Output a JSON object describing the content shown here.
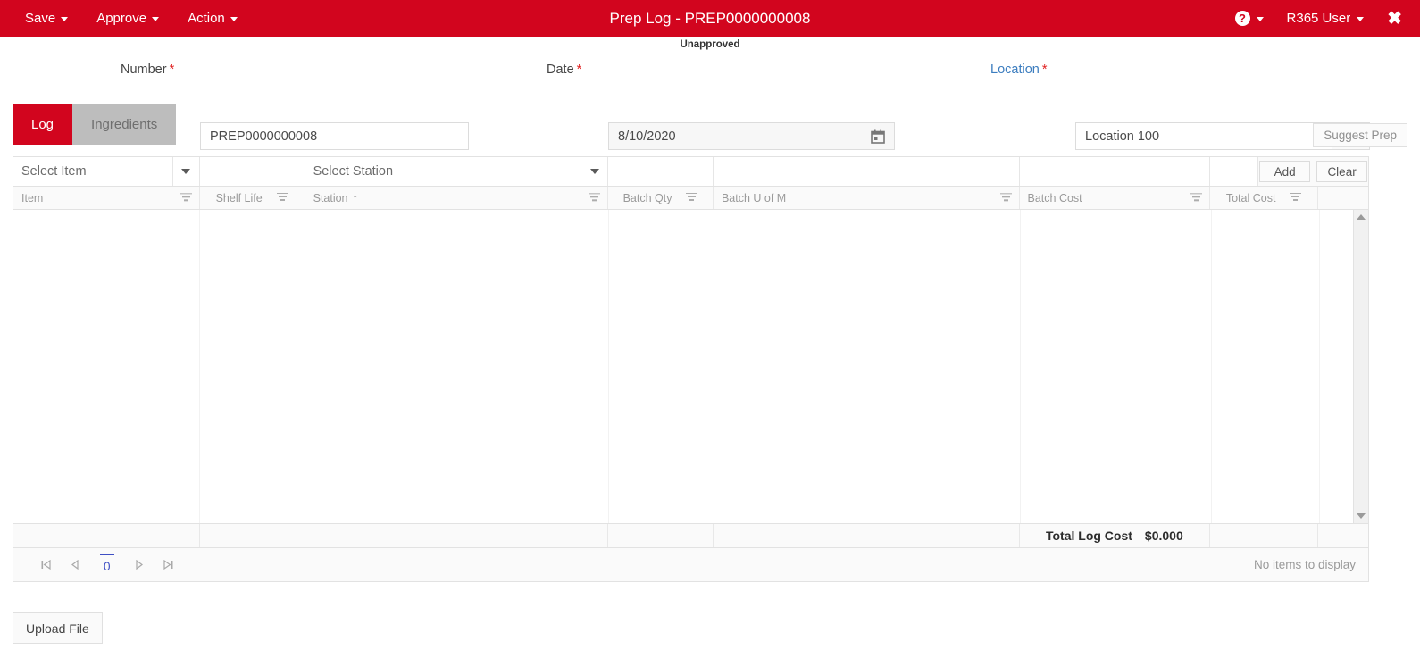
{
  "topbar": {
    "menus": [
      {
        "label": "Save",
        "name": "menu-save"
      },
      {
        "label": "Approve",
        "name": "menu-approve"
      },
      {
        "label": "Action",
        "name": "menu-action"
      }
    ],
    "title": "Prep Log - PREP0000000008",
    "help_glyph": "?",
    "user_label": "R365 User",
    "close_glyph": "✖",
    "bg_color": "#d2051e"
  },
  "status": {
    "text": "Unapproved"
  },
  "form": {
    "number": {
      "label": "Number",
      "required": "*",
      "value": "PREP0000000008"
    },
    "date": {
      "label": "Date",
      "required": "*",
      "value": "8/10/2020"
    },
    "location": {
      "label": "Location",
      "required": "*",
      "value": "Location 100"
    }
  },
  "tabs": [
    {
      "label": "Log",
      "active": true
    },
    {
      "label": "Ingredients",
      "active": false
    }
  ],
  "actions": {
    "suggest_prep": "Suggest Prep",
    "add": "Add",
    "clear": "Clear",
    "upload_file": "Upload File"
  },
  "entry_row": {
    "item_placeholder": "Select Item",
    "shelf_life_value": "",
    "station_placeholder": "Select Station",
    "batch_qty_value": "",
    "batch_uom_value": "",
    "batch_cost_value": "",
    "total_cost_value": ""
  },
  "grid": {
    "columns": [
      {
        "header": "Item",
        "align": "left",
        "sorted": ""
      },
      {
        "header": "Shelf Life",
        "align": "center",
        "sorted": ""
      },
      {
        "header": "Station",
        "align": "left",
        "sorted": "↑"
      },
      {
        "header": "Batch Qty",
        "align": "center",
        "sorted": ""
      },
      {
        "header": "Batch U of M",
        "align": "left",
        "sorted": ""
      },
      {
        "header": "Batch Cost",
        "align": "left",
        "sorted": ""
      },
      {
        "header": "Total Cost",
        "align": "center",
        "sorted": ""
      }
    ],
    "rows": [],
    "total_label": "Total Log Cost",
    "total_value": "$0.000",
    "empty_text": "No items to display",
    "pager": {
      "first_glyph": "⏮",
      "prev_glyph": "◀",
      "page_number": "0",
      "next_glyph": "▶",
      "last_glyph": "⏭"
    }
  }
}
